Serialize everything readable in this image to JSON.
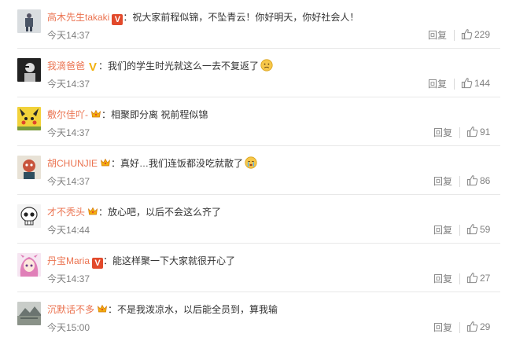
{
  "colors": {
    "name": "#eb7350",
    "meta": "#808080",
    "text": "#333333",
    "vip": "#e2492b",
    "crown": "#f2b10e"
  },
  "comments": [
    {
      "name": "高木先生takaki",
      "badge": "V",
      "colon": "：",
      "text": "祝大家前程似锦，不坠青云！你好明天，你好社会人！",
      "time": "今天14:37",
      "reply": "回复",
      "likes": "229",
      "avatar_icon": "figure-avatar-icon",
      "emoji": ""
    },
    {
      "name": "我滴爸爸",
      "badge": "V",
      "colon": "：",
      "text": "我们的学生时光就这么一去不复返了",
      "time": "今天14:37",
      "reply": "回复",
      "likes": "144",
      "avatar_icon": "dark-portrait-avatar-icon",
      "emoji": "sad-face"
    },
    {
      "name": "敷尔佳吖-",
      "badge": "crown",
      "colon": "：",
      "text": "相聚即分离 祝前程似锦",
      "time": "今天14:37",
      "reply": "回复",
      "likes": "91",
      "avatar_icon": "pikachu-avatar-icon",
      "emoji": ""
    },
    {
      "name": "胡CHUNJIE",
      "badge": "crown",
      "colon": "：",
      "text": "真好…我们连饭都没吃就散了",
      "time": "今天14:37",
      "reply": "回复",
      "likes": "86",
      "avatar_icon": "cartoon-avatar-icon",
      "emoji": "crying-face"
    },
    {
      "name": "才不秃头",
      "badge": "crown",
      "colon": "：",
      "text": "放心吧，以后不会这么齐了",
      "time": "今天14:44",
      "reply": "回复",
      "likes": "59",
      "avatar_icon": "skull-avatar-icon",
      "emoji": ""
    },
    {
      "name": "丹宝Maria",
      "badge": "V",
      "colon": "：",
      "text": "能这样聚一下大家就很开心了",
      "time": "今天14:37",
      "reply": "回复",
      "likes": "27",
      "avatar_icon": "anime-girl-avatar-icon",
      "emoji": ""
    },
    {
      "name": "沉默话不多",
      "badge": "crown",
      "colon": "：",
      "text": "不是我泼凉水，以后能全员到，算我输",
      "time": "今天15:00",
      "reply": "回复",
      "likes": "29",
      "avatar_icon": "landscape-avatar-icon",
      "emoji": ""
    }
  ]
}
